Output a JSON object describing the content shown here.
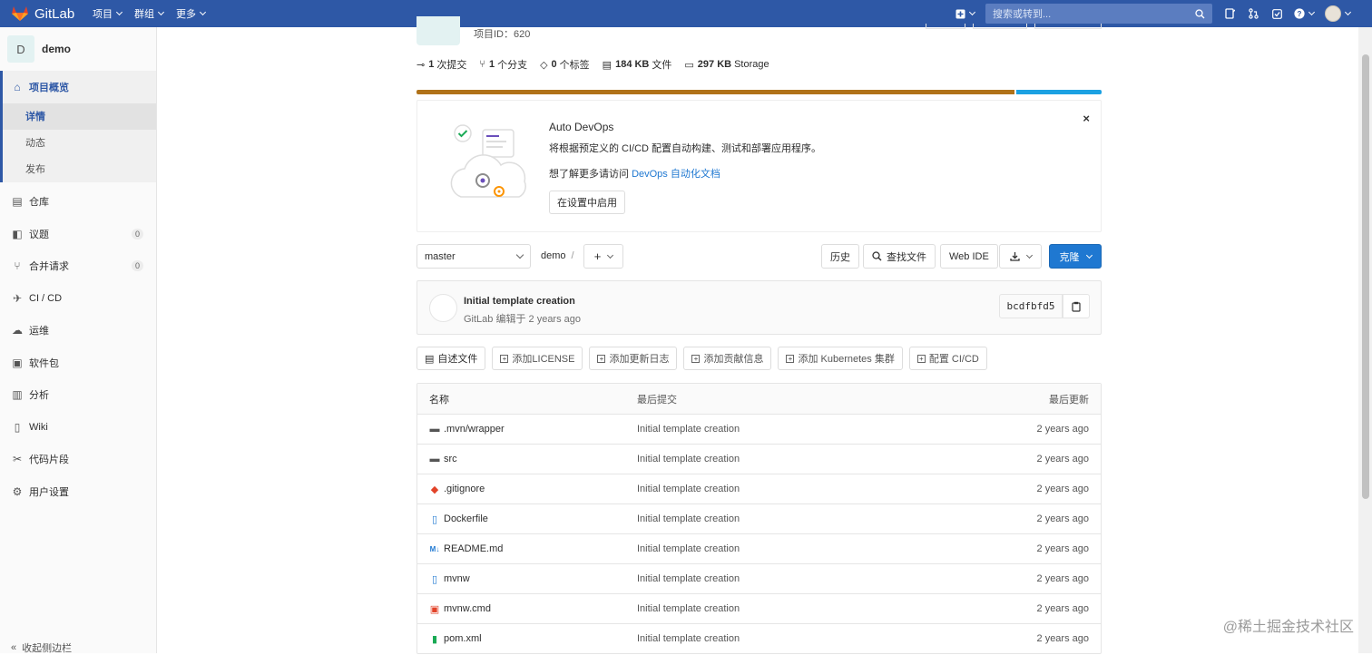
{
  "nav": {
    "brand": "GitLab",
    "menus": [
      "项目",
      "群组",
      "更多"
    ],
    "search_placeholder": "搜索或转到..."
  },
  "sidebar": {
    "project_initial": "D",
    "project_name": "demo",
    "overview": "项目概览",
    "overview_sub": [
      "详情",
      "动态",
      "发布"
    ],
    "items": [
      {
        "label": "仓库",
        "icon": "repo-icon"
      },
      {
        "label": "议题",
        "icon": "issues-icon",
        "badge": "0"
      },
      {
        "label": "合并请求",
        "icon": "merge-request-icon",
        "badge": "0"
      },
      {
        "label": "CI / CD",
        "icon": "rocket-icon"
      },
      {
        "label": "运维",
        "icon": "cloud-icon"
      },
      {
        "label": "软件包",
        "icon": "package-icon"
      },
      {
        "label": "分析",
        "icon": "chart-icon"
      },
      {
        "label": "Wiki",
        "icon": "book-icon"
      },
      {
        "label": "代码片段",
        "icon": "scissors-icon"
      },
      {
        "label": "用户设置",
        "icon": "gear-icon"
      }
    ],
    "collapse": "收起侧边栏"
  },
  "project": {
    "id_label": "项目ID：620",
    "stats": [
      {
        "value": "1",
        "label": "次提交"
      },
      {
        "value": "1",
        "label": "个分支"
      },
      {
        "value": "0",
        "label": "个标签"
      },
      {
        "value": "184 KB",
        "label": "文件"
      },
      {
        "value": "297 KB",
        "label": "Storage"
      }
    ],
    "languages": [
      {
        "color": "#b07219",
        "share": 0.875
      },
      {
        "color": "#1ba1e2",
        "share": 0.125
      }
    ]
  },
  "devops": {
    "title": "Auto DevOps",
    "desc": "将根据预定义的 CI/CD 配置自动构建、测试和部署应用程序。",
    "more_prefix": "想了解更多请访问 ",
    "more_link": "DevOps 自动化文档",
    "enable_button": "在设置中启用",
    "close": "×"
  },
  "toolbar": {
    "branch": "master",
    "path": "demo",
    "path_sep": "/",
    "add": "+",
    "history": "历史",
    "find_file": "查找文件",
    "web_ide": "Web IDE",
    "clone": "克隆"
  },
  "commit": {
    "title": "Initial template creation",
    "meta": "GitLab 编辑于 2 years ago",
    "sha": "bcdfbfd5"
  },
  "quick_actions": [
    "自述文件",
    "添加LICENSE",
    "添加更新日志",
    "添加贡献信息",
    "添加 Kubernetes 集群",
    "配置 CI/CD"
  ],
  "table": {
    "headers": {
      "name": "名称",
      "commit": "最后提交",
      "updated": "最后更新"
    },
    "rows": [
      {
        "name": ".mvn/wrapper",
        "commit": "Initial template creation",
        "time": "2 years ago",
        "icon": "folder-icon"
      },
      {
        "name": "src",
        "commit": "Initial template creation",
        "time": "2 years ago",
        "icon": "folder-icon"
      },
      {
        "name": ".gitignore",
        "commit": "Initial template creation",
        "time": "2 years ago",
        "icon": "git-icon"
      },
      {
        "name": "Dockerfile",
        "commit": "Initial template creation",
        "time": "2 years ago",
        "icon": "file-icon"
      },
      {
        "name": "README.md",
        "commit": "Initial template creation",
        "time": "2 years ago",
        "icon": "markdown-icon"
      },
      {
        "name": "mvnw",
        "commit": "Initial template creation",
        "time": "2 years ago",
        "icon": "file-icon"
      },
      {
        "name": "mvnw.cmd",
        "commit": "Initial template creation",
        "time": "2 years ago",
        "icon": "terminal-icon"
      },
      {
        "name": "pom.xml",
        "commit": "Initial template creation",
        "time": "2 years ago",
        "icon": "xml-icon"
      }
    ]
  },
  "watermark": "@稀土掘金技术社区"
}
